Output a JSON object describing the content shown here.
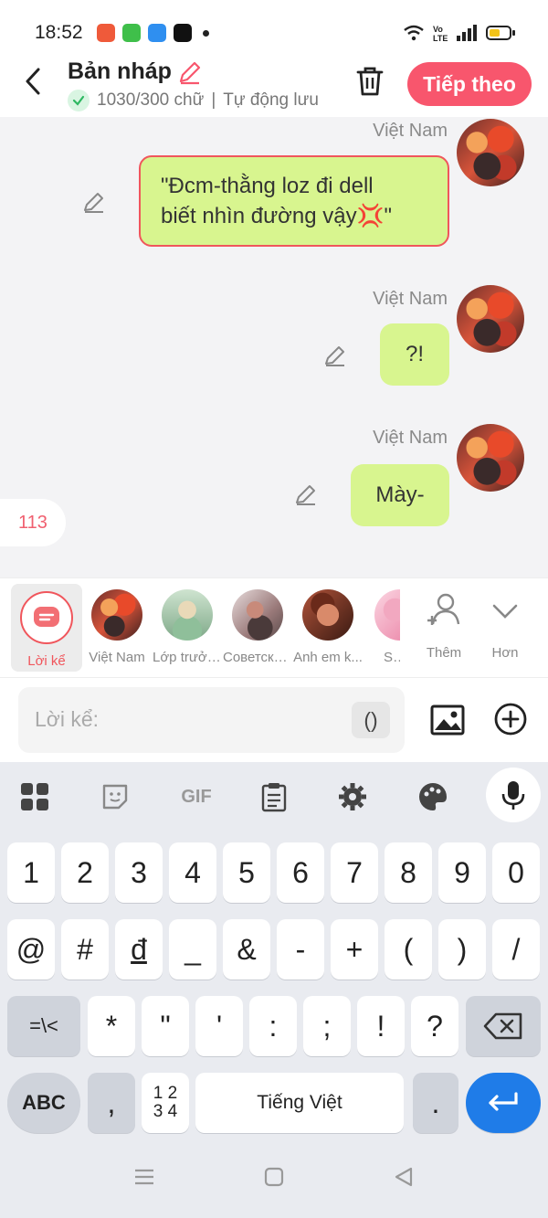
{
  "status_bar": {
    "time": "18:52"
  },
  "header": {
    "title": "Bản nháp",
    "word_count": "1030/300 chữ",
    "separator": "|",
    "autosave": "Tự động lưu",
    "next_label": "Tiếp theo"
  },
  "messages": [
    {
      "sender": "Việt Nam",
      "text_line1": "\"Đcm-thằng loz đi dell",
      "text_line2": "biết nhìn đường vậy💢\""
    },
    {
      "sender": "Việt Nam",
      "text": "?!"
    },
    {
      "sender": "Việt Nam",
      "text": "Mày-"
    }
  ],
  "counter": "113",
  "characters": [
    {
      "label": "Lời kể"
    },
    {
      "label": "Việt Nam"
    },
    {
      "label": "Lớp trưởn..."
    },
    {
      "label": "Советски..."
    },
    {
      "label": "Anh em k..."
    },
    {
      "label": "So"
    },
    {
      "label": "Thêm"
    },
    {
      "label": "Hơn"
    }
  ],
  "input": {
    "placeholder": "Lời kể:",
    "paren": "()"
  },
  "keyboard": {
    "row1": [
      "1",
      "2",
      "3",
      "4",
      "5",
      "6",
      "7",
      "8",
      "9",
      "0"
    ],
    "row2": [
      "@",
      "#",
      "đ",
      "_",
      "&",
      "-",
      "+",
      "(",
      ")",
      "/"
    ],
    "row3_left": "=\\<",
    "row3": [
      "*",
      "\"",
      "'",
      ":",
      ";",
      "!",
      "?"
    ],
    "abc": "ABC",
    "comma": ",",
    "num_top": "1 2",
    "num_bottom": "3 4",
    "space": "Tiếng Việt",
    "period": "."
  },
  "colors": {
    "accent": "#f8566d",
    "bubble": "#d8f58f",
    "enter": "#1f7ce8"
  }
}
